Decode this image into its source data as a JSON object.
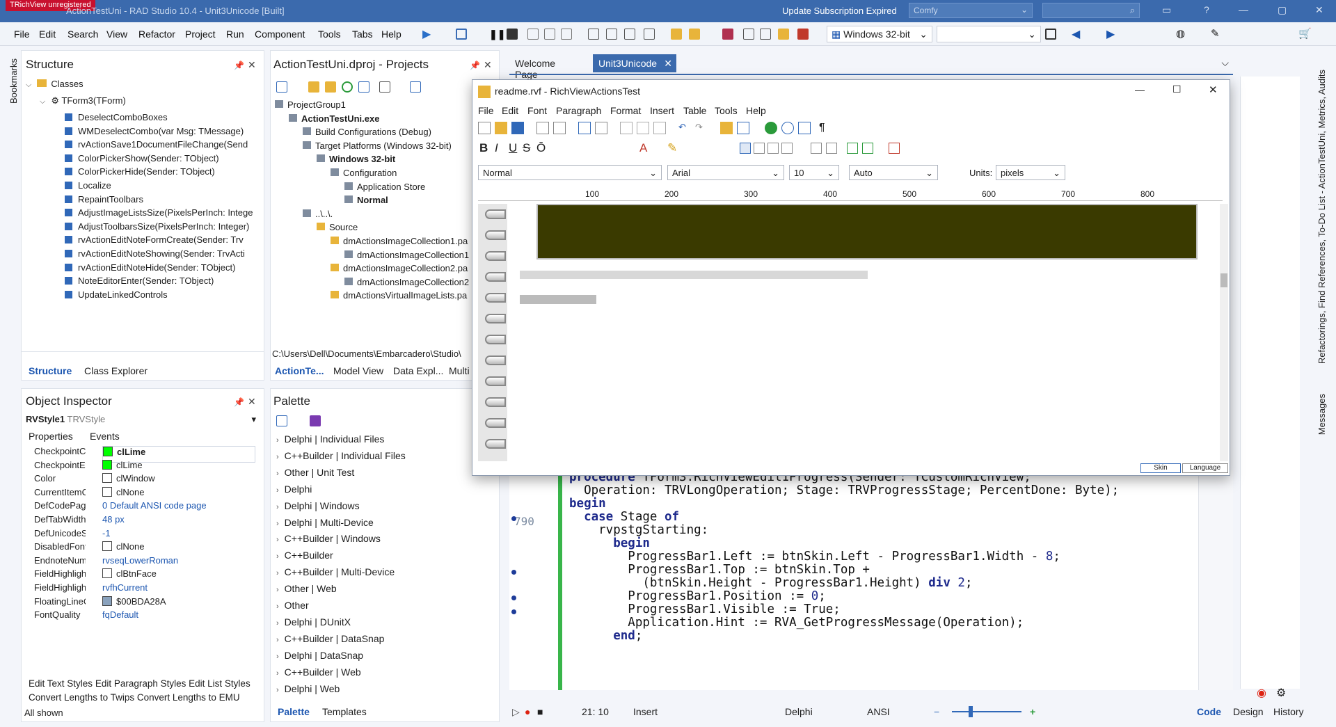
{
  "window": {
    "title": "ActionTestUni - RAD Studio 10.4 - Unit3Unicode [Built]",
    "unregistered": "TRichView unregistered",
    "subscription": "Update Subscription Expired",
    "layout_combo": "Comfy"
  },
  "menu": [
    "File",
    "Edit",
    "Search",
    "View",
    "Refactor",
    "Project",
    "Run",
    "Component",
    "Tools",
    "Tabs",
    "Help"
  ],
  "toolbar": {
    "platform": "Windows 32-bit"
  },
  "structure": {
    "title": "Structure",
    "root": "Classes",
    "form": "TForm3(TForm)",
    "items": [
      "DeselectComboBoxes",
      "WMDeselectCombo(var Msg: TMessage)",
      "rvActionSave1DocumentFileChange(Send",
      "ColorPickerShow(Sender: TObject)",
      "ColorPickerHide(Sender: TObject)",
      "Localize",
      "RepaintToolbars",
      "AdjustImageListsSize(PixelsPerInch: Intege",
      "AdjustToolbarsSize(PixelsPerInch: Integer)",
      "rvActionEditNoteFormCreate(Sender: Trv",
      "rvActionEditNoteShowing(Sender: TrvActi",
      "rvActionEditNoteHide(Sender: TObject)",
      "NoteEditorEnter(Sender: TObject)",
      "UpdateLinkedControls"
    ],
    "tabs": [
      "Structure",
      "Class Explorer"
    ]
  },
  "projects": {
    "title": "ActionTestUni.dproj - Projects",
    "rows": [
      {
        "text": "ProjectGroup1",
        "indent": 0,
        "bold": false
      },
      {
        "text": "ActionTestUni.exe",
        "indent": 1,
        "bold": true
      },
      {
        "text": "Build Configurations (Debug)",
        "indent": 2,
        "bold": false
      },
      {
        "text": "Target Platforms (Windows 32-bit)",
        "indent": 2,
        "bold": false
      },
      {
        "text": "Windows 32-bit",
        "indent": 3,
        "bold": true
      },
      {
        "text": "Configuration",
        "indent": 4,
        "bold": false
      },
      {
        "text": "Application Store",
        "indent": 5,
        "bold": false
      },
      {
        "text": "Normal",
        "indent": 5,
        "bold": true
      },
      {
        "text": "..\\..\\.",
        "indent": 2,
        "bold": false
      },
      {
        "text": "Source",
        "indent": 3,
        "bold": false
      },
      {
        "text": "dmActionsImageCollection1.pa",
        "indent": 4,
        "bold": false
      },
      {
        "text": "dmActionsImageCollection1",
        "indent": 5,
        "bold": false
      },
      {
        "text": "dmActionsImageCollection2.pa",
        "indent": 4,
        "bold": false
      },
      {
        "text": "dmActionsImageCollection2",
        "indent": 5,
        "bold": false
      },
      {
        "text": "dmActionsVirtualImageLists.pa",
        "indent": 4,
        "bold": false
      }
    ],
    "path": "C:\\Users\\Dell\\Documents\\Embarcadero\\Studio\\",
    "tabs": [
      "ActionTe...",
      "Model View",
      "Data Expl...",
      "Multi"
    ]
  },
  "inspector": {
    "title": "Object Inspector",
    "object": "RVStyle1",
    "class": "TRVStyle",
    "tabs": [
      "Properties",
      "Events"
    ],
    "rows": [
      {
        "name": "CheckpointCc",
        "value": "clLime",
        "swatch": "#00ff00",
        "bold": true
      },
      {
        "name": "CheckpointEv",
        "value": "clLime",
        "swatch": "#00ff00",
        "bold": false
      },
      {
        "name": "Color",
        "value": "clWindow",
        "swatch": "#ffffff",
        "bold": false
      },
      {
        "name": "CurrentItemC",
        "value": "clNone",
        "swatch": "#ffffff",
        "bold": false
      },
      {
        "name": "DefCodePage",
        "value": "0 Default ANSI code page",
        "swatch": "",
        "bold": false
      },
      {
        "name": "DefTabWidth",
        "value": "48 px",
        "swatch": "",
        "bold": false
      },
      {
        "name": "DefUnicodeSt",
        "value": "-1",
        "swatch": "",
        "bold": false
      },
      {
        "name": "DisabledFont",
        "value": "clNone",
        "swatch": "#ffffff",
        "bold": false
      },
      {
        "name": "EndnoteNum",
        "value": "rvseqLowerRoman",
        "swatch": "",
        "bold": false
      },
      {
        "name": "FieldHighlight",
        "value": "clBtnFace",
        "swatch": "#ffffff",
        "bold": false
      },
      {
        "name": "FieldHighlight",
        "value": "rvfhCurrent",
        "swatch": "",
        "bold": false
      },
      {
        "name": "FloatingLineC",
        "value": "$00BDA28A",
        "swatch": "#8aa2bd",
        "bold": false
      },
      {
        "name": "FontQuality",
        "value": "fqDefault",
        "swatch": "",
        "bold": false
      }
    ],
    "links": [
      "Edit Text Styles",
      "Edit Paragraph Styles",
      "Edit List Styles",
      "Convert Lengths to Twips",
      "Convert Lengths to EMU"
    ],
    "footer": "All shown"
  },
  "palette": {
    "title": "Palette",
    "items": [
      "Delphi | Individual Files",
      "C++Builder | Individual Files",
      "Other | Unit Test",
      "Delphi",
      "Delphi | Windows",
      "Delphi | Multi-Device",
      "C++Builder | Windows",
      "C++Builder",
      "C++Builder | Multi-Device",
      "Other | Web",
      "Other",
      "Delphi | DUnitX",
      "C++Builder | DataSnap",
      "Delphi | DataSnap",
      "C++Builder | Web",
      "Delphi | Web"
    ],
    "tabs": [
      "Palette",
      "Templates"
    ]
  },
  "editor": {
    "tabs": [
      "Welcome Page",
      "Unit3Unicode"
    ],
    "line_number": "790",
    "status": {
      "position": "21: 10",
      "mode": "Insert",
      "lang": "Delphi",
      "encoding": "ANSI"
    },
    "view_tabs": [
      "Code",
      "Design",
      "History"
    ]
  },
  "dialog": {
    "title": "readme.rvf - RichViewActionsTest",
    "menu": [
      "File",
      "Edit",
      "Font",
      "Paragraph",
      "Format",
      "Insert",
      "Table",
      "Tools",
      "Help"
    ],
    "style": "Normal",
    "font": "Arial",
    "size": "10",
    "lang": "Auto",
    "units_label": "Units:",
    "units": "pixels",
    "ruler": [
      "100",
      "200",
      "300",
      "400",
      "500",
      "600",
      "700",
      "800"
    ],
    "buttons": [
      "Skin",
      "Language"
    ]
  },
  "right_tabs": {
    "top": "Refactorings, Find References, To-Do List - ActionTestUni, Metrics, Audits",
    "bottom": "Messages"
  },
  "bookmarks": "Bookmarks"
}
